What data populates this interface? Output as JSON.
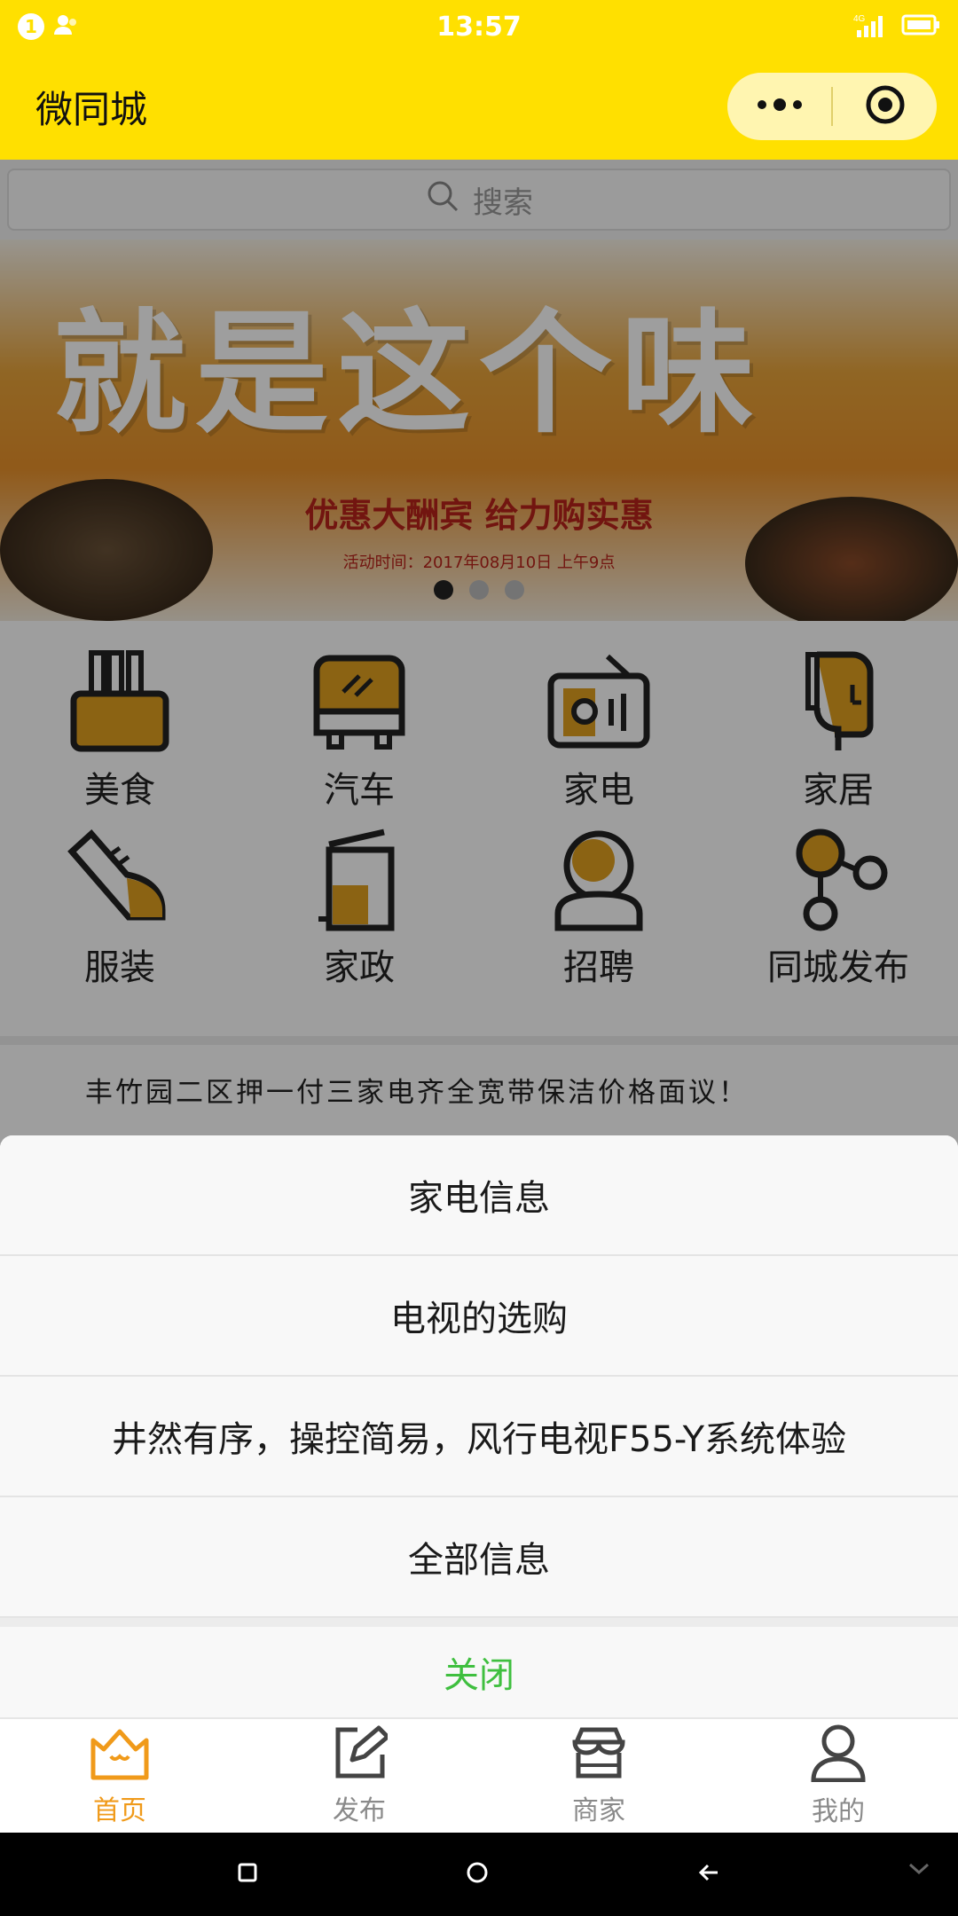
{
  "status_bar": {
    "notification_count": "1",
    "time": "13:57",
    "network": "4G"
  },
  "nav": {
    "title": "微同城"
  },
  "search": {
    "placeholder": "搜索"
  },
  "banner": {
    "headline": "就是这个味",
    "subtitle": "优惠大酬宾 给力购实惠",
    "date_text": "活动时间：2017年08月10日 上午9点",
    "slide_count": 3,
    "active_slide": 1
  },
  "categories": [
    {
      "label": "美食",
      "icon": "food-basket-icon"
    },
    {
      "label": "汽车",
      "icon": "bus-icon"
    },
    {
      "label": "家电",
      "icon": "radio-icon"
    },
    {
      "label": "家居",
      "icon": "hairdryer-icon"
    },
    {
      "label": "服装",
      "icon": "shoe-icon"
    },
    {
      "label": "家政",
      "icon": "trash-can-icon"
    },
    {
      "label": "招聘",
      "icon": "person-badge-icon"
    },
    {
      "label": "同城发布",
      "icon": "share-nodes-icon"
    }
  ],
  "notice": {
    "text": "丰竹园二区押一付三家电齐全宽带保洁价格面议！"
  },
  "action_sheet": {
    "items": [
      "家电信息",
      "电视的选购",
      "井然有序，操控简易，风行电视F55-Y系统体验",
      "全部信息"
    ],
    "close_label": "关闭"
  },
  "tab_bar": {
    "tabs": [
      {
        "label": "首页",
        "icon": "home-cat-icon",
        "active": true
      },
      {
        "label": "发布",
        "icon": "edit-icon",
        "active": false
      },
      {
        "label": "商家",
        "icon": "store-icon",
        "active": false
      },
      {
        "label": "我的",
        "icon": "user-icon",
        "active": false
      }
    ]
  },
  "colors": {
    "header_yellow": "#ffe000",
    "accent_orange": "#f09a1a",
    "close_green": "#3fbf3f",
    "icon_gold": "#e0a020"
  }
}
